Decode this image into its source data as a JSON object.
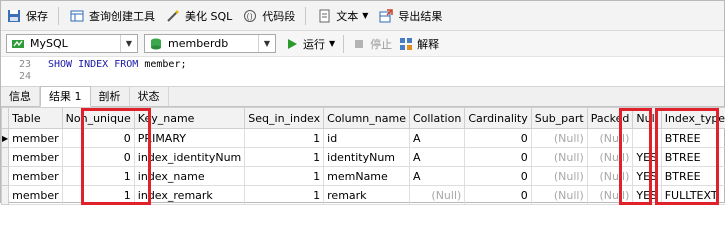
{
  "toolbar": {
    "save": "保存",
    "query_builder": "查询创建工具",
    "beautify": "美化 SQL",
    "snippet": "代码段",
    "text": "文本",
    "export": "导出结果"
  },
  "dbbar": {
    "connection": "MySQL",
    "database": "memberdb",
    "run": "运行",
    "stop": "停止",
    "explain": "解释"
  },
  "editor": {
    "lines": [
      {
        "num": "23",
        "keyword": "SHOW INDEX FROM",
        "ident": "member;"
      },
      {
        "num": "24",
        "keyword": "",
        "ident": ""
      }
    ]
  },
  "tabs": [
    "信息",
    "结果 1",
    "剖析",
    "状态"
  ],
  "grid": {
    "columns": [
      "Table",
      "Non_unique",
      "Key_name",
      "Seq_in_index",
      "Column_name",
      "Collation",
      "Cardinality",
      "Sub_part",
      "Packed",
      "Null",
      "Index_type"
    ],
    "rows": [
      [
        "member",
        "0",
        "PRIMARY",
        "1",
        "id",
        "A",
        "0",
        "(Null)",
        "(Null)",
        "",
        "BTREE"
      ],
      [
        "member",
        "0",
        "index_identityNum",
        "1",
        "identityNum",
        "A",
        "0",
        "(Null)",
        "(Null)",
        "YES",
        "BTREE"
      ],
      [
        "member",
        "1",
        "index_name",
        "1",
        "memName",
        "A",
        "0",
        "(Null)",
        "(Null)",
        "YES",
        "BTREE"
      ],
      [
        "member",
        "1",
        "index_remark",
        "1",
        "remark",
        "(Null)",
        "0",
        "(Null)",
        "(Null)",
        "YES",
        "FULLTEXT"
      ]
    ]
  },
  "colors": {
    "highlight": "#e0202a",
    "null_text": "#a8a8a8",
    "sql_keyword": "#1a1aa6",
    "run_green": "#2a9a2a"
  }
}
